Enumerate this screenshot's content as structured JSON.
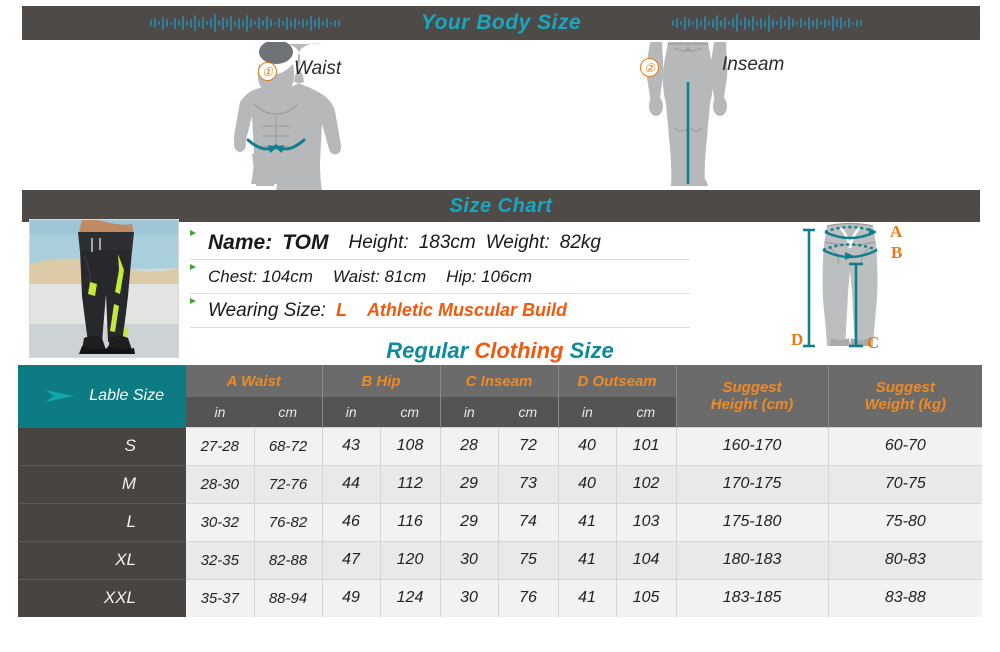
{
  "banners": {
    "body_size_title": "Your Body Size",
    "size_chart_title": "Size Chart"
  },
  "figures": [
    {
      "badge": "①",
      "label": "Waist",
      "icon": "male-torso-icon"
    },
    {
      "badge": "②",
      "label": "Inseam",
      "icon": "male-legs-icon"
    }
  ],
  "model_info": {
    "name_label": "Name:",
    "name_value": "TOM",
    "height_label": "Height:",
    "height_value": "183cm",
    "weight_label": "Weight:",
    "weight_value": "82kg",
    "chest": "Chest: 104cm",
    "waist": "Waist: 81cm",
    "hip": "Hip: 106cm",
    "wearing_size_label": "Wearing Size:",
    "wearing_size_value": "L",
    "build": "Athletic Muscular Build"
  },
  "pants_diagram": {
    "a": "A",
    "b": "B",
    "c": "C",
    "d": "D"
  },
  "chart_title": {
    "part1": "Regular",
    "part2": "Clothing",
    "part3": "Size"
  },
  "colors": {
    "teal": "#0d8a9b",
    "orange": "#f05a10",
    "header_gray": "#6b6b6b",
    "banner_gray": "#4d4a47",
    "label_teal": "#0c7b83",
    "accent_blue": "#17a8c0"
  },
  "table": {
    "label_header": "Lable Size",
    "groups": [
      {
        "name": "A Waist",
        "units": [
          "in",
          "cm"
        ]
      },
      {
        "name": "B Hip",
        "units": [
          "in",
          "cm"
        ]
      },
      {
        "name": "C Inseam",
        "units": [
          "in",
          "cm"
        ]
      },
      {
        "name": "D Outseam",
        "units": [
          "in",
          "cm"
        ]
      }
    ],
    "suggest_height": "Suggest\nHeight (cm)",
    "suggest_height_l1": "Suggest",
    "suggest_height_l2": "Height (cm)",
    "suggest_weight_l1": "Suggest",
    "suggest_weight_l2": "Weight (kg)",
    "rows": [
      {
        "size": "S",
        "waist_in": "27-28",
        "waist_cm": "68-72",
        "hip_in": "43",
        "hip_cm": "108",
        "inseam_in": "28",
        "inseam_cm": "72",
        "outseam_in": "40",
        "outseam_cm": "101",
        "height": "160-170",
        "weight": "60-70"
      },
      {
        "size": "M",
        "waist_in": "28-30",
        "waist_cm": "72-76",
        "hip_in": "44",
        "hip_cm": "112",
        "inseam_in": "29",
        "inseam_cm": "73",
        "outseam_in": "40",
        "outseam_cm": "102",
        "height": "170-175",
        "weight": "70-75"
      },
      {
        "size": "L",
        "waist_in": "30-32",
        "waist_cm": "76-82",
        "hip_in": "46",
        "hip_cm": "116",
        "inseam_in": "29",
        "inseam_cm": "74",
        "outseam_in": "41",
        "outseam_cm": "103",
        "height": "175-180",
        "weight": "75-80"
      },
      {
        "size": "XL",
        "waist_in": "32-35",
        "waist_cm": "82-88",
        "hip_in": "47",
        "hip_cm": "120",
        "inseam_in": "30",
        "inseam_cm": "75",
        "outseam_in": "41",
        "outseam_cm": "104",
        "height": "180-183",
        "weight": "80-83"
      },
      {
        "size": "XXL",
        "waist_in": "35-37",
        "waist_cm": "88-94",
        "hip_in": "49",
        "hip_cm": "124",
        "inseam_in": "30",
        "inseam_cm": "76",
        "outseam_in": "41",
        "outseam_cm": "105",
        "height": "183-185",
        "weight": "83-88"
      }
    ]
  }
}
